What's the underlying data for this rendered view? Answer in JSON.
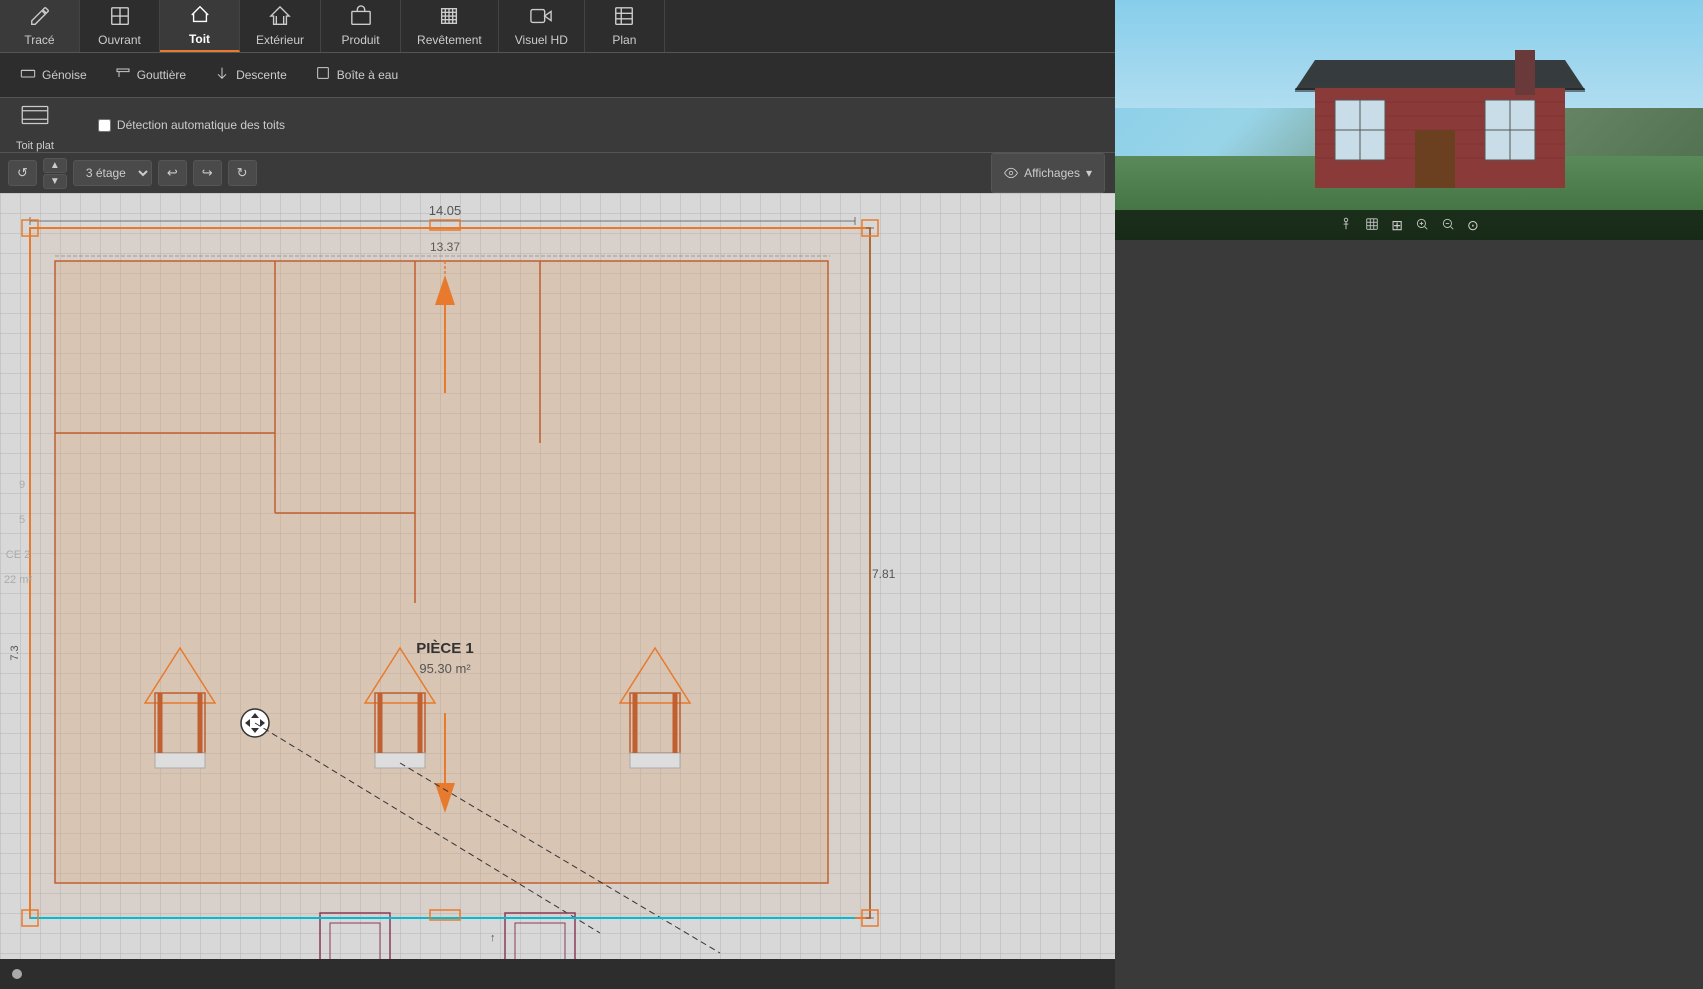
{
  "toolbar": {
    "items": [
      {
        "id": "trace",
        "label": "Tracé",
        "icon": "✏️",
        "active": false
      },
      {
        "id": "ouvrant",
        "label": "Ouvrant",
        "icon": "🪟",
        "active": false
      },
      {
        "id": "toit",
        "label": "Toit",
        "icon": "🏠",
        "active": true
      },
      {
        "id": "exterieur",
        "label": "Extérieur",
        "icon": "🌳",
        "active": false
      },
      {
        "id": "produit",
        "label": "Produit",
        "icon": "📦",
        "active": false
      },
      {
        "id": "revetement",
        "label": "Revêtement",
        "icon": "🪣",
        "active": false
      },
      {
        "id": "visuel_hd",
        "label": "Visuel HD",
        "icon": "📷",
        "active": false
      },
      {
        "id": "plan",
        "label": "Plan",
        "icon": "📋",
        "active": false
      }
    ],
    "right_icons": [
      "?",
      "💬",
      "⊡",
      "⛶",
      "✕"
    ]
  },
  "second_toolbar": {
    "items": [
      {
        "id": "genoise",
        "label": "Génoise",
        "icon": "▭"
      },
      {
        "id": "gouttiere",
        "label": "Gouttière",
        "icon": "⌐"
      },
      {
        "id": "descente",
        "label": "Descente",
        "icon": "↓"
      },
      {
        "id": "boite_a_eau",
        "label": "Boîte à eau",
        "icon": "□"
      }
    ]
  },
  "toit_toolbar": {
    "items": [
      {
        "id": "toit_plat",
        "label": "Toit plat",
        "icon": "⬜"
      }
    ],
    "detection_label": "Détection automatique des toits"
  },
  "canvas_toolbar": {
    "rotate_btn": "↺",
    "up_btn": "▲",
    "down_btn": "▼",
    "stage": "3 étage",
    "undo": "↩",
    "redo": "↪",
    "refresh": "↻",
    "affichages": "Affichages"
  },
  "floor_plan": {
    "dimension_top": "14.05",
    "dimension_top2": "13.37",
    "dimension_right": "7.81",
    "dimension_left_top": "7.3",
    "room_name": "PIÈCE 1",
    "room_area": "95.30 m²",
    "side_labels": [
      "9",
      "5",
      "CE 2",
      "22 m²"
    ]
  },
  "view_3d_toolbar": {
    "buttons": [
      "👤",
      "⊞",
      "🔲",
      "🔍+",
      "🔍-",
      "⊙"
    ]
  },
  "bottom_bar": {
    "dot_color": "#aaa"
  }
}
